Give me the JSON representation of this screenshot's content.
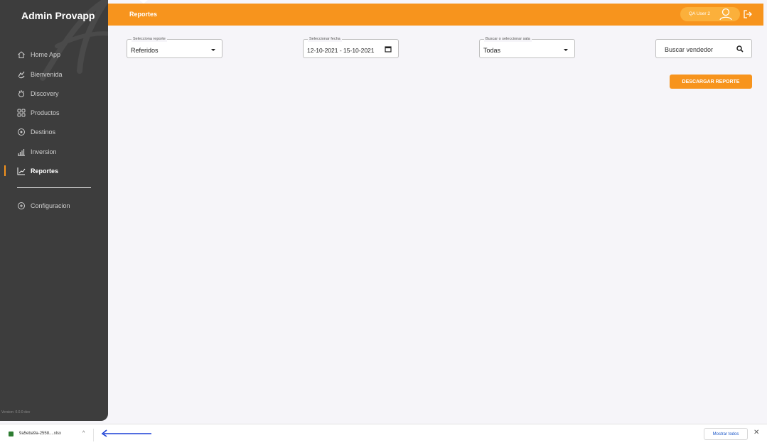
{
  "brand": "Admin Provapp",
  "version": "Version: 0.0.0-dev",
  "sidebar": {
    "items": [
      {
        "label": "Home App",
        "icon": "home-icon"
      },
      {
        "label": "Bienvenida",
        "icon": "hands-icon"
      },
      {
        "label": "Discovery",
        "icon": "discovery-icon"
      },
      {
        "label": "Productos",
        "icon": "grid-icon"
      },
      {
        "label": "Destinos",
        "icon": "location-icon"
      },
      {
        "label": "Inversion",
        "icon": "bar-chart-icon"
      },
      {
        "label": "Reportes",
        "icon": "line-chart-icon",
        "active": true
      },
      {
        "label": "Configuracion",
        "icon": "settings-icon"
      }
    ]
  },
  "topbar": {
    "title": "Reportes",
    "user": "QA User 2"
  },
  "filters": {
    "report": {
      "legend": "Selecciona reporte",
      "value": "Referidos"
    },
    "date": {
      "legend": "Seleccionar fecha",
      "value": "12-10-2021 - 15-10-2021"
    },
    "room": {
      "legend": "Buscar o seleccionar sala",
      "value": "Todas"
    },
    "seller_search": {
      "placeholder": "Buscar vendedor"
    }
  },
  "download_button": "DESCARGAR REPORTE",
  "download_bar": {
    "file": "9a5eba9a-2558....xlsx",
    "show_all": "Mostrar todos",
    "close": "✕"
  },
  "colors": {
    "accent": "#f7941d",
    "sidebar": "#3d3d3d",
    "background": "#f6f5f9",
    "link": "#1a56c8"
  }
}
